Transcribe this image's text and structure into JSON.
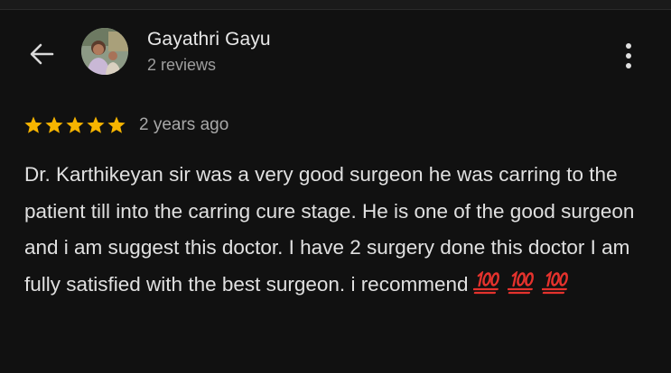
{
  "reviewer": {
    "name": "Gayathri Gayu",
    "review_count": "2 reviews",
    "avatar_icon": "avatar-photo"
  },
  "icons": {
    "back": "arrow-left-icon",
    "menu": "more-vertical-icon",
    "star": "star-icon"
  },
  "rating": {
    "stars": 5,
    "max": 5,
    "age": "2 years ago"
  },
  "review": {
    "text": "Dr. Karthikeyan sir was a very good surgeon he was carring to the patient till into the carring cure stage. He is one of the good surgeon and i am suggest this doctor. I have 2 surgery done this doctor I am fully satisfied with the best surgeon. i recommend",
    "emojis": [
      "💯",
      "💯",
      "💯"
    ]
  },
  "colors": {
    "background": "#111111",
    "star": "#f6b400",
    "emoji": "#e5322d"
  }
}
